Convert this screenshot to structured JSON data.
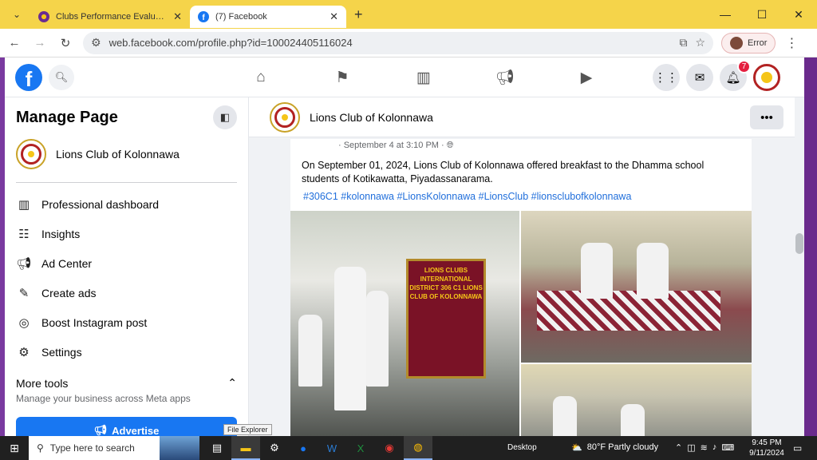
{
  "browser": {
    "tabs": [
      {
        "title": "Clubs Performance Evaluation Syst",
        "active": false
      },
      {
        "title": "(7) Facebook",
        "active": true
      }
    ],
    "url": "web.facebook.com/profile.php?id=100024405116024",
    "error_label": "Error"
  },
  "fb": {
    "notification_count": "7"
  },
  "sidebar": {
    "title": "Manage Page",
    "page_name": "Lions Club of Kolonnawa",
    "items": [
      {
        "label": "Professional dashboard",
        "icon": "chart-icon"
      },
      {
        "label": "Insights",
        "icon": "insights-icon"
      },
      {
        "label": "Ad Center",
        "icon": "megaphone-icon"
      },
      {
        "label": "Create ads",
        "icon": "pencil-icon"
      },
      {
        "label": "Boost Instagram post",
        "icon": "instagram-icon"
      },
      {
        "label": "Settings",
        "icon": "gear-icon"
      }
    ],
    "more_tools": "More tools",
    "more_tools_sub": "Manage your business across Meta apps",
    "advertise": "Advertise"
  },
  "main": {
    "page_name": "Lions Club of Kolonnawa",
    "post": {
      "meta": "· September 4 at 3:10 PM · ",
      "text": "On September 01, 2024, Lions Club of Kolonnawa offered breakfast to the Dhamma school students of Kotikawatta, Piyadassanarama.",
      "tags": "#306C1 #kolonnawa #LionsKolonnawa #LionsClub #lionsclubofkolonnawa",
      "banner_text": "LIONS CLUBS INTERNATIONAL DISTRICT 306 C1 LIONS CLUB OF KOLONNAWA"
    }
  },
  "taskbar": {
    "search_placeholder": "Type here to search",
    "tooltip": "File Explorer",
    "desktop": "Desktop",
    "weather": "80°F  Partly cloudy",
    "time": "9:45 PM",
    "date": "9/11/2024"
  }
}
